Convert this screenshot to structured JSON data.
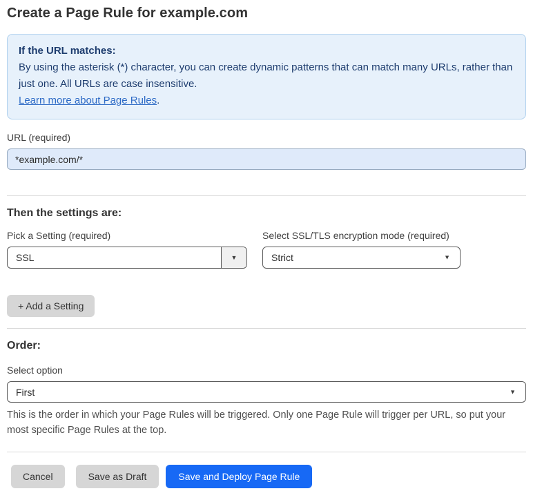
{
  "page": {
    "title": "Create a Page Rule for example.com"
  },
  "info_box": {
    "heading": "If the URL matches:",
    "body": "By using the asterisk (*) character, you can create dynamic patterns that can match many URLs, rather than just one. All URLs are case insensitive.",
    "link_label": "Learn more about Page Rules",
    "link_suffix": "."
  },
  "url_field": {
    "label": "URL (required)",
    "value": "*example.com/*"
  },
  "settings_section": {
    "heading": "Then the settings are:",
    "setting_picker": {
      "label": "Pick a Setting (required)",
      "selected": "SSL"
    },
    "ssl_mode_picker": {
      "label": "Select SSL/TLS encryption mode (required)",
      "selected": "Strict"
    },
    "add_setting_label": "+ Add a Setting"
  },
  "order_section": {
    "heading": "Order:",
    "select_label": "Select option",
    "selected": "First",
    "help_text": "This is the order in which your Page Rules will be triggered. Only one Page Rule will trigger per URL, so put your most specific Page Rules at the top."
  },
  "footer": {
    "cancel_label": "Cancel",
    "save_draft_label": "Save as Draft",
    "save_deploy_label": "Save and Deploy Page Rule"
  },
  "icons": {
    "dropdown_arrow": "▼"
  },
  "colors": {
    "accent_blue": "#1769f5",
    "info_bg": "#e7f1fb",
    "info_border": "#b0d1ee",
    "info_text": "#1d3c6e",
    "link_blue": "#2e6bc6",
    "input_bg": "#dfeafa"
  }
}
